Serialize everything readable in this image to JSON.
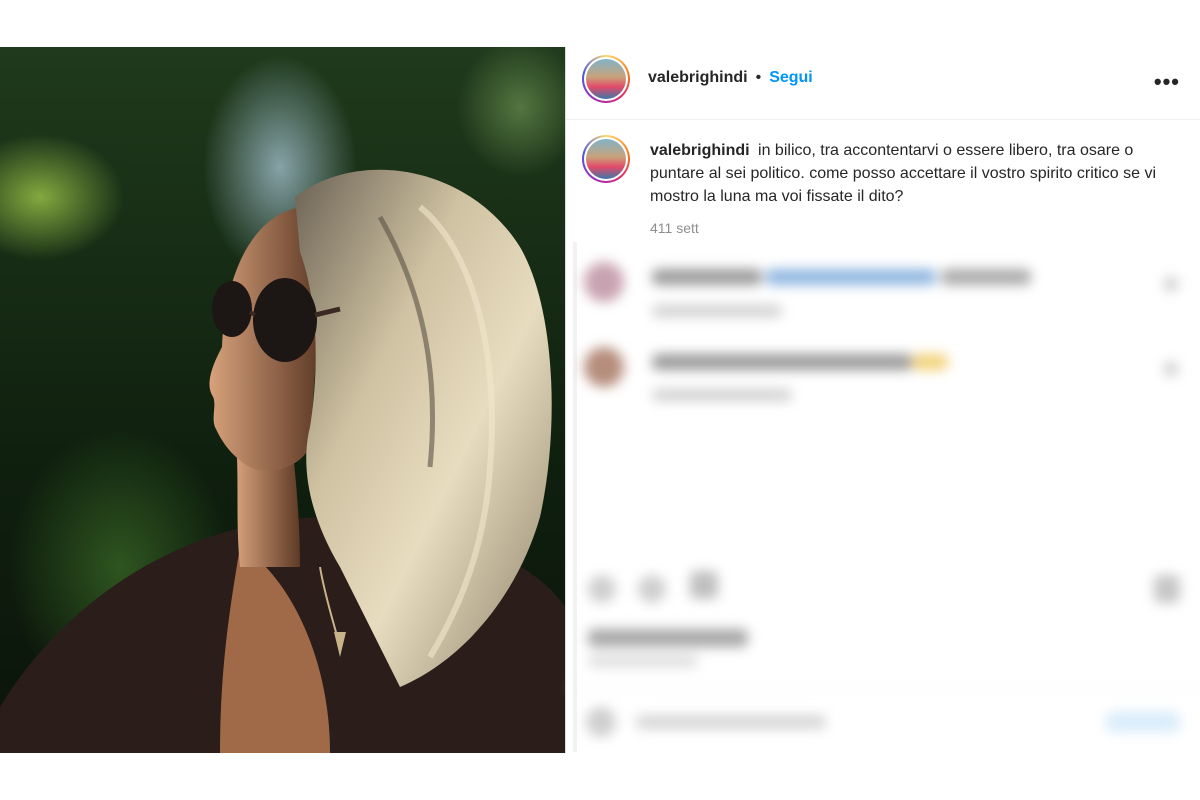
{
  "post": {
    "username": "valebrighindi",
    "separator": "•",
    "follow_label": "Segui",
    "more_icon": "•••",
    "caption_user": "valebrighindi",
    "caption_text": "in bilico, tra accontentarvi o essere libero, tra osare o puntare al sei politico. come posso accettare il vostro spirito critico se vi mostro la luna ma voi fissate il dito?",
    "time_ago": "411 sett"
  },
  "colors": {
    "follow_blue": "#0095f6",
    "text": "#262626",
    "muted": "#8e8e8e"
  },
  "icons": [
    "more-options-icon",
    "profile-avatar",
    "like-icon",
    "comment-icon",
    "share-icon",
    "save-icon",
    "emoji-icon"
  ]
}
